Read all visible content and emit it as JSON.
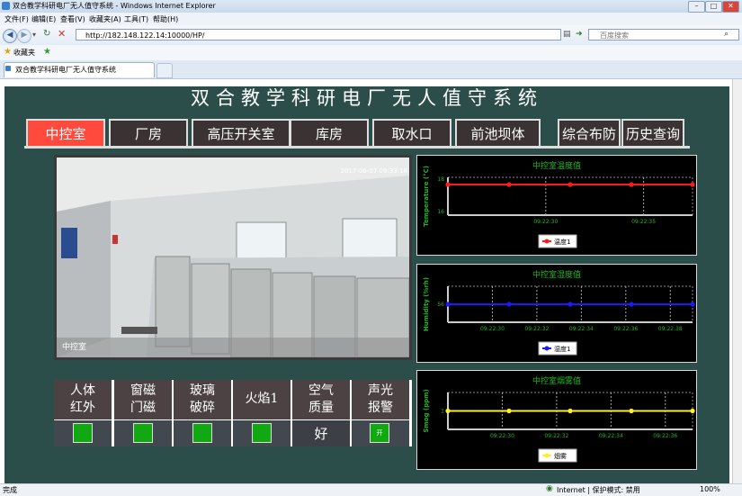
{
  "window": {
    "title": "双合教学科研电厂无人值守系统 - Windows Internet Explorer",
    "buttons": [
      "–",
      "□",
      "✕"
    ]
  },
  "menu": [
    "文件(F)",
    "编辑(E)",
    "查看(V)",
    "收藏夹(A)",
    "工具(T)",
    "帮助(H)"
  ],
  "address": {
    "url": "http://182.148.122.14:10000/HP/",
    "search_placeholder": "百度搜索"
  },
  "favorites": {
    "label": "收藏夹"
  },
  "tabs": [
    {
      "label": "双合教学科研电厂无人值守系统"
    }
  ],
  "system": {
    "title": "双合教学科研电厂无人值守系统"
  },
  "nav": {
    "tabs": [
      {
        "label": "中控室",
        "active": true
      },
      {
        "label": "厂房"
      },
      {
        "label": "高压开关室"
      },
      {
        "label": "库房"
      },
      {
        "label": "取水口"
      },
      {
        "label": "前池坝体"
      },
      {
        "label": "综合布防"
      },
      {
        "label": "历史查询"
      }
    ]
  },
  "camera": {
    "timestamp": "2017-06-07 09:33:14",
    "location": "中控室"
  },
  "sensors": {
    "headers": [
      {
        "line1": "人体",
        "line2": "红外"
      },
      {
        "line1": "窗磁",
        "line2": "门磁"
      },
      {
        "line1": "玻璃",
        "line2": "破碎"
      },
      {
        "line1": "火焰1",
        "line2": ""
      },
      {
        "line1": "空气",
        "line2": "质量"
      },
      {
        "line1": "声光",
        "line2": "报警"
      }
    ],
    "air_quality": "好",
    "alarm_button": "开",
    "status_color": "#11a911"
  },
  "chart_data": [
    {
      "type": "line",
      "title": "中控室温度值",
      "ylabel": "Temperature (°C)",
      "yticks": [
        "18",
        "16"
      ],
      "xticks": [
        "09:22:30",
        "09:22:35"
      ],
      "series": [
        {
          "name": "温度1",
          "color": "#ff1a1a",
          "values": [
            17.6,
            17.6,
            17.6,
            17.6,
            17.6
          ]
        }
      ]
    },
    {
      "type": "line",
      "title": "中控室湿度值",
      "ylabel": "Humidity (%rh)",
      "yticks": [
        "56"
      ],
      "xticks": [
        "09:22:30",
        "09:22:32",
        "09:22:34",
        "09:22:36",
        "09:22:38"
      ],
      "series": [
        {
          "name": "湿度1",
          "color": "#1a1aff",
          "values": [
            56,
            56,
            56,
            56,
            56
          ]
        }
      ]
    },
    {
      "type": "line",
      "title": "中控室烟雾值",
      "ylabel": "Smog (ppm)",
      "yticks": [
        "1"
      ],
      "xticks": [
        "09:22:30",
        "09:22:32",
        "09:22:34",
        "09:22:36"
      ],
      "series": [
        {
          "name": "烟雾",
          "color": "#ffee22",
          "values": [
            1.2,
            1.2,
            1.2,
            1.2,
            1.2
          ]
        }
      ]
    }
  ],
  "status": {
    "left": "完成",
    "zone": "Internet | 保护模式: 禁用",
    "zoom": "100%"
  }
}
